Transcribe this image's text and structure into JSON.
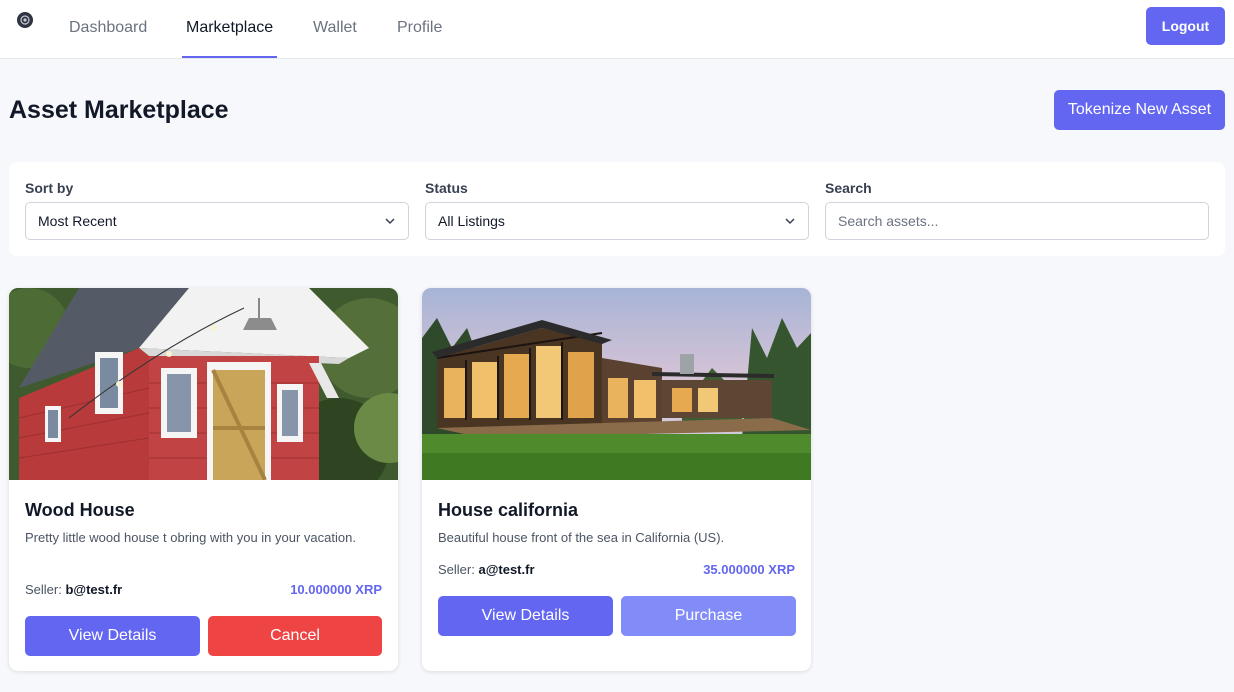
{
  "nav": {
    "links": [
      {
        "label": "Dashboard"
      },
      {
        "label": "Marketplace",
        "active": true
      },
      {
        "label": "Wallet"
      },
      {
        "label": "Profile"
      }
    ],
    "logout_label": "Logout"
  },
  "header": {
    "title": "Asset Marketplace",
    "tokenize_label": "Tokenize New Asset"
  },
  "filters": {
    "sort": {
      "label": "Sort by",
      "value": "Most Recent"
    },
    "status": {
      "label": "Status",
      "value": "All Listings"
    },
    "search": {
      "label": "Search",
      "placeholder": "Search assets..."
    }
  },
  "listings": [
    {
      "title": "Wood House",
      "description": "Pretty little wood house t obring with you in your vacation.",
      "seller_label": "Seller:",
      "seller": "b@test.fr",
      "price": "10.000000 XRP",
      "primary_action": "View Details",
      "secondary_action": "Cancel"
    },
    {
      "title": "House california",
      "description": "Beautiful house front of the sea in California (US).",
      "seller_label": "Seller:",
      "seller": "a@test.fr",
      "price": "35.000000 XRP",
      "primary_action": "View Details",
      "secondary_action": "Purchase"
    }
  ],
  "colors": {
    "accent": "#6366f1",
    "danger": "#ef4444",
    "accent_light": "#818cf8"
  }
}
